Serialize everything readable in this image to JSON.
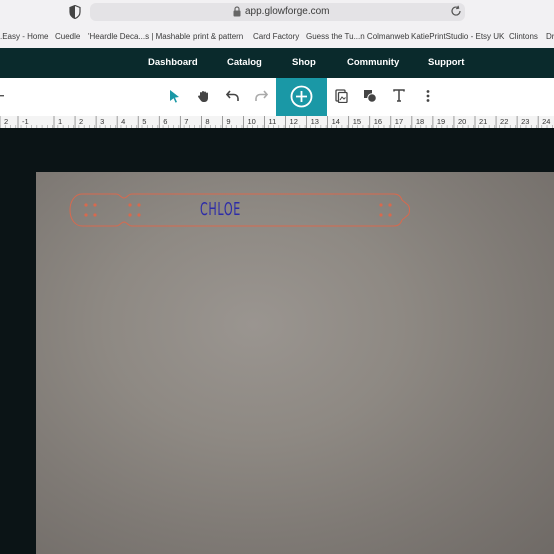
{
  "browser": {
    "url": "app.glowforge.com",
    "bookmarks": [
      ".Easy - Home",
      "Cuedle",
      "'Heardle Deca...s | Mashable",
      "print & pattern",
      "Card Factory",
      "Guess the Tu...n Colmanweb",
      "KatiePrintStudio - Etsy UK",
      "Clintons",
      "Dr"
    ]
  },
  "nav": {
    "items": [
      "Dashboard",
      "Catalog",
      "Shop",
      "Community",
      "Support"
    ]
  },
  "toolbar": {
    "icons": [
      "select-arrow-icon",
      "hand-pan-icon",
      "undo-icon",
      "redo-icon",
      "add-plus-icon",
      "trace-image-icon",
      "shapes-icon",
      "text-icon",
      "more-menu-icon"
    ],
    "accent": "#1a98a6"
  },
  "ruler": {
    "labels": [
      "2",
      "-1",
      "1",
      "2",
      "3",
      "4",
      "5",
      "6",
      "7",
      "8",
      "9",
      "10",
      "11",
      "12",
      "13",
      "14",
      "15",
      "16",
      "17",
      "18",
      "19",
      "20",
      "21",
      "22",
      "23",
      "24"
    ]
  },
  "design": {
    "name_text": "CHLOE",
    "cut_color": "#d8694e",
    "engrave_color": "#2d2ca8"
  }
}
